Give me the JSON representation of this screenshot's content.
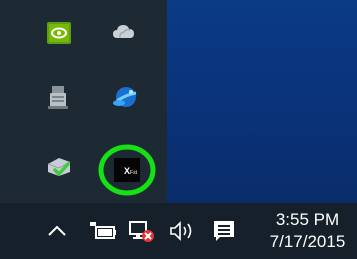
{
  "tray_overflow": {
    "icons": [
      {
        "name": "nvidia-icon"
      },
      {
        "name": "onedrive-icon"
      },
      {
        "name": "usb-device-icon"
      },
      {
        "name": "bluetooth-icon"
      },
      {
        "name": "network-adapter-icon"
      },
      {
        "name": "xfast-icon",
        "label": "XFast",
        "highlighted": true,
        "highlight_color": "#16e016"
      }
    ]
  },
  "taskbar": {
    "show_hidden_icons": "chevron-up-icon",
    "power_icon": "battery-charging-icon",
    "network_icon": "network-disconnected-icon",
    "volume_icon": "speaker-icon",
    "action_center_icon": "action-center-icon"
  },
  "clock": {
    "time": "3:55 PM",
    "date": "7/17/2015"
  },
  "colors": {
    "tray_bg": "#1d2a33",
    "taskbar_bg": "#16202a",
    "desktop_blue": "#0b3a86",
    "highlight_ring": "#16e016"
  }
}
